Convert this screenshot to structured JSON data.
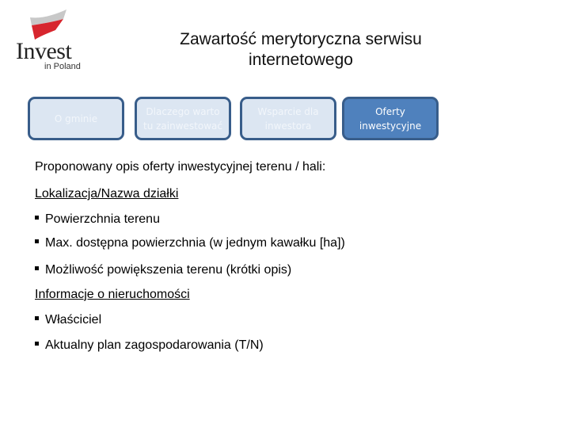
{
  "logo": {
    "word": "Invest",
    "sub": "in Poland",
    "colors": {
      "red": "#d7262e",
      "gray": "#c8c8c8"
    }
  },
  "header": {
    "title_line1": "Zawartość merytoryczna serwisu",
    "title_line2": "internetowego"
  },
  "nav": {
    "colors": {
      "fill": "#dce6f2",
      "border": "#385d8a",
      "active_fill": "#4f81bd"
    },
    "items": [
      {
        "label": "O gminie",
        "active": false
      },
      {
        "label": "Dlaczego warto tu zainwestować",
        "active": false
      },
      {
        "label": "Wsparcie dla inwestora",
        "active": false
      },
      {
        "label": "Oferty inwestycyjne",
        "active": true
      }
    ]
  },
  "content": {
    "intro": "Proponowany opis oferty inwestycyjnej terenu / hali:",
    "section1": {
      "heading": "Lokalizacja/Nazwa działki",
      "bullets": [
        "Powierzchnia terenu",
        "Max. dostępna powierzchnia (w jednym kawałku [ha])",
        "Możliwość powiększenia terenu (krótki opis)"
      ]
    },
    "section2": {
      "heading": "Informacje o nieruchomości",
      "bullets": [
        "Właściciel",
        "Aktualny plan zagospodarowania (T/N)"
      ]
    }
  }
}
